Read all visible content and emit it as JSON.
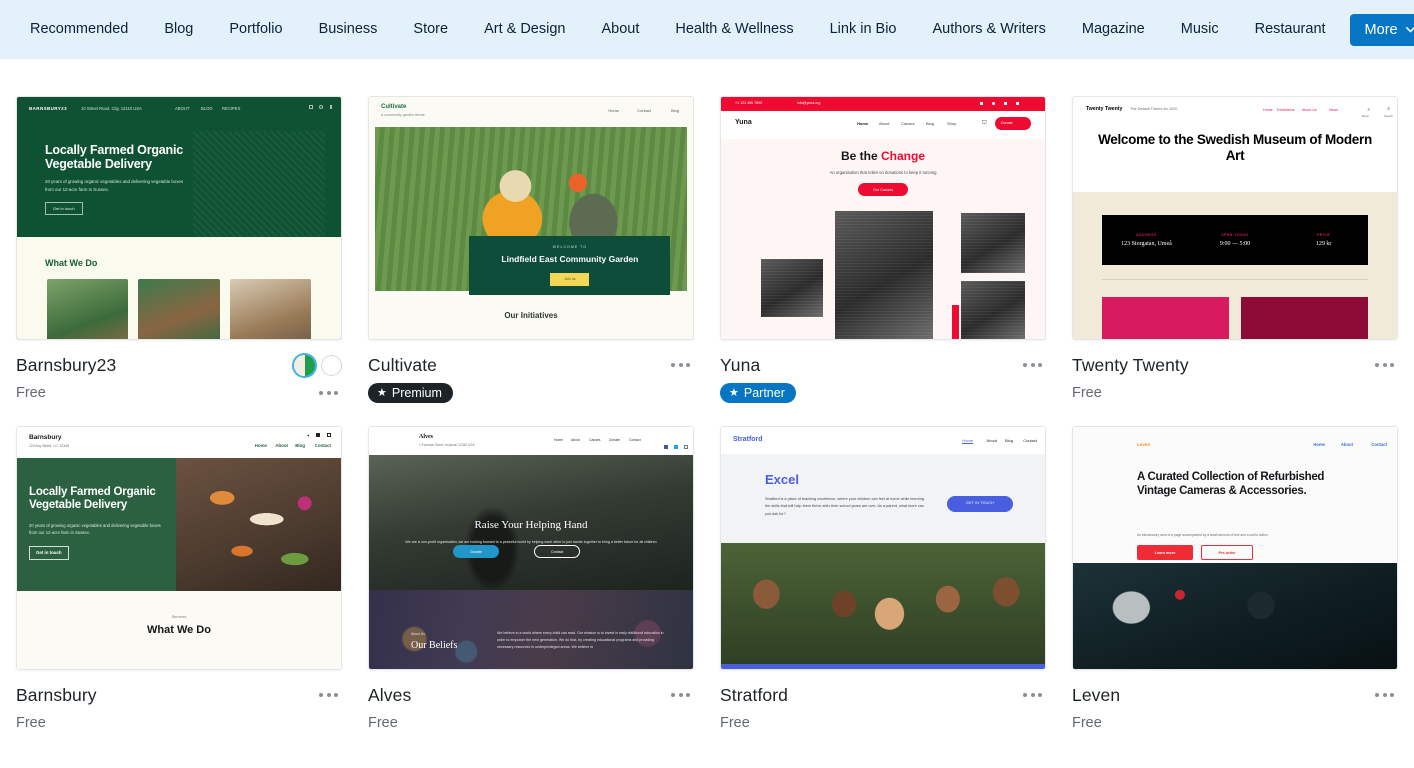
{
  "nav": {
    "items": [
      {
        "label": "Recommended"
      },
      {
        "label": "Blog"
      },
      {
        "label": "Portfolio"
      },
      {
        "label": "Business"
      },
      {
        "label": "Store"
      },
      {
        "label": "Art & Design"
      },
      {
        "label": "About"
      },
      {
        "label": "Health & Wellness"
      },
      {
        "label": "Link in Bio"
      },
      {
        "label": "Authors & Writers"
      },
      {
        "label": "Magazine"
      },
      {
        "label": "Music"
      },
      {
        "label": "Restaurant"
      }
    ],
    "more_label": "More",
    "more_icon": "chevron-down-icon",
    "background_color": "#e3f1fb",
    "more_button_color": "#0675c4"
  },
  "themes": [
    {
      "name": "Barnsbury23",
      "price": "Free",
      "badge": null,
      "swatches": [
        {
          "name": "cream-green",
          "colors": [
            "#f2efe2",
            "#1e9e4a"
          ],
          "selected": true
        },
        {
          "name": "white",
          "colors": [
            "#ffffff"
          ],
          "selected": false
        }
      ],
      "preview": {
        "logo": "BARNSBURY23",
        "address": "10 Street Road, City, 12110 USA",
        "nav": [
          "ABOUT",
          "BLOG",
          "RECIPES"
        ],
        "heading": "Locally Farmed Organic Vegetable Delivery",
        "body": "20 years of growing organic vegetables and delivering vegetable boxes from our 12-acre farm in Sussex.",
        "button": "Get in touch",
        "section_title": "What We Do"
      }
    },
    {
      "name": "Cultivate",
      "price": null,
      "badge": {
        "label": "Premium",
        "type": "premium",
        "icon": "star-icon",
        "color": "#1d2327"
      },
      "swatches": [],
      "preview": {
        "logo": "Cultivate",
        "tagline": "A community garden theme",
        "nav": [
          "Home",
          "Contact",
          "Blog"
        ],
        "eyebrow": "WELCOME TO",
        "heading": "Lindfield East Community Garden",
        "button": "Join us",
        "section_title": "Our Initiatives"
      }
    },
    {
      "name": "Yuna",
      "price": null,
      "badge": {
        "label": "Partner",
        "type": "partner",
        "icon": "star-icon",
        "color": "#0675c4"
      },
      "swatches": [],
      "preview": {
        "logo": "Yuna",
        "topbar": [
          "+1 123 456 7890",
          "info@yuna.org"
        ],
        "nav": [
          "Home",
          "About",
          "Causes",
          "Blog",
          "Shop"
        ],
        "cta": "Donate",
        "heading_plain": "Be the ",
        "heading_light": "the ",
        "heading_accent": "Change",
        "body": "An organisation that relies on donations to keep it running",
        "button": "Our Causes"
      }
    },
    {
      "name": "Twenty Twenty",
      "price": "Free",
      "badge": null,
      "swatches": [],
      "preview": {
        "logo": "Twenty Twenty",
        "tagline": "The Default Theme for 2020",
        "nav": [
          "Home",
          "Exhibitions",
          "About Us",
          "News"
        ],
        "menu_label": "Menu",
        "search_label": "Search",
        "heading": "Welcome to the Swedish Museum of Modern Art",
        "info": [
          {
            "label": "ADDRESS",
            "value": "123 Storgatan, Umeå"
          },
          {
            "label": "OPEN TODAY",
            "value": "9:00 — 5:00"
          },
          {
            "label": "PRICE",
            "value": "129 kr"
          }
        ]
      }
    },
    {
      "name": "Barnsbury",
      "price": "Free",
      "badge": null,
      "swatches": [],
      "preview": {
        "logo": "Barnsbury",
        "address": "123 Any Street, I.O. 12345",
        "nav": [
          "Home",
          "About",
          "Blog",
          "Contact"
        ],
        "heading": "Locally Farmed Organic Vegetable Delivery",
        "body": "20 years of growing organic vegetables and delivering vegetable boxes from our 12-acre farm in Sussex.",
        "button": "Get in touch",
        "eyebrow": "Services",
        "section_title": "What We Do"
      }
    },
    {
      "name": "Alves",
      "price": "Free",
      "badge": null,
      "swatches": [],
      "preview": {
        "logo": "Alves",
        "address": "1 Example Street, Anytown 12345 USA",
        "nav": [
          "Home",
          "About",
          "Causes",
          "Donate",
          "Contact"
        ],
        "heading": "Raise Your Helping Hand",
        "body": "We are a non-profit organisation, we are looking forward to a peaceful world by helping each other to join hands together to bring a better future for all children",
        "buttons": [
          "Donate",
          "Contact"
        ],
        "eyebrow": "About Us",
        "section_title": "Our Beliefs",
        "section_body": "We believe in a world where every child can read. Our mission is to invest in early childhood education in order to empower the next generation. We do that, by creating educational programs and providing necessary resources in underprivileged areas. We believe in"
      }
    },
    {
      "name": "Stratford",
      "price": "Free",
      "badge": null,
      "swatches": [],
      "preview": {
        "logo": "Stratford",
        "nav": [
          "Home",
          "About",
          "Blog",
          "Contact"
        ],
        "heading": "Excel",
        "body": "Stratford is a place of teaching excellence, where your children can feel at home while learning the skills that will help them thrive after their school years are over. As a parent, what more can you ask for?",
        "button": "GET IN TOUCH"
      }
    },
    {
      "name": "Leven",
      "price": "Free",
      "badge": null,
      "swatches": [],
      "preview": {
        "logo": "Leven",
        "nav": [
          "Home",
          "About",
          "Contact"
        ],
        "heading": "A Curated Collection of Refurbished Vintage Cameras & Accessories.",
        "body": "An introductory area of a page accompanied by a small amount of text and a call to action.",
        "buttons": [
          "Learn more",
          "Pre-order"
        ]
      }
    }
  ],
  "menu_icon_name": "ellipsis-icon"
}
